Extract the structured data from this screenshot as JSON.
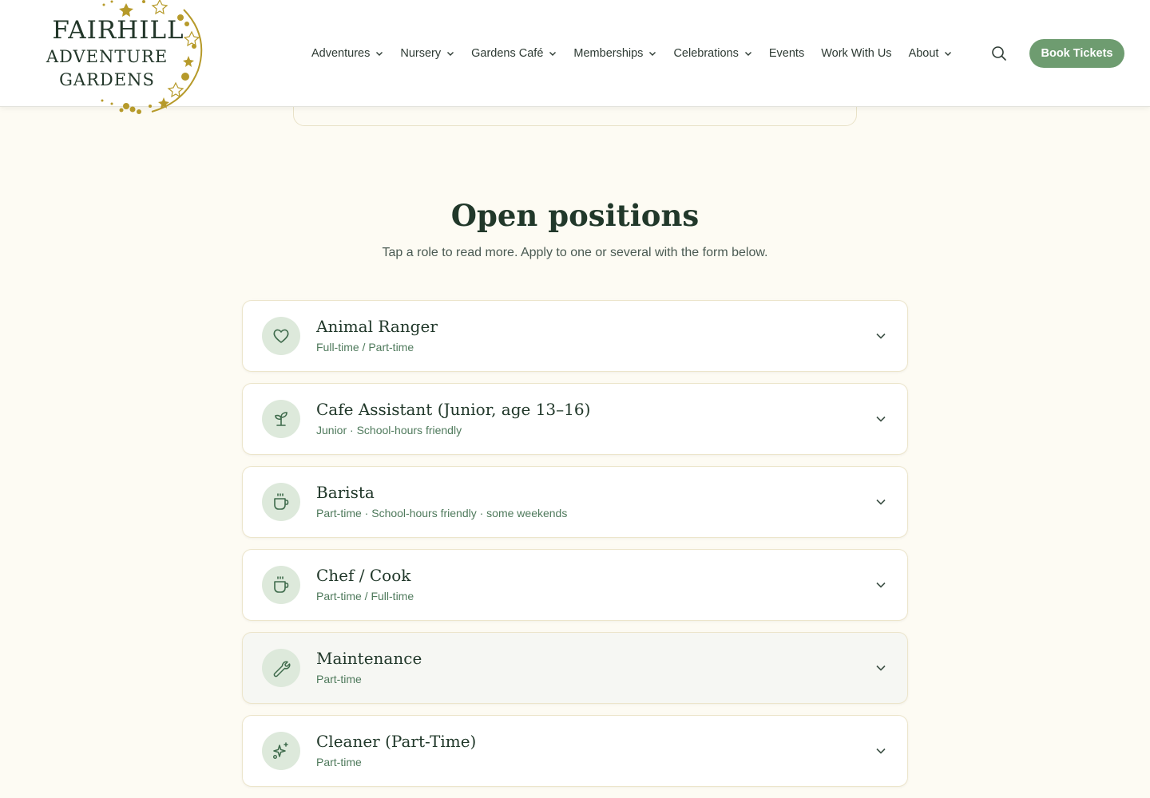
{
  "brand": {
    "line1": "FAIRHILL",
    "line2": "ADVENTURE",
    "line3": "GARDENS",
    "accent": "#b69a2a"
  },
  "nav": {
    "items": [
      {
        "label": "Adventures",
        "has_dropdown": true
      },
      {
        "label": "Nursery",
        "has_dropdown": true
      },
      {
        "label": "Gardens Café",
        "has_dropdown": true
      },
      {
        "label": "Memberships",
        "has_dropdown": true
      },
      {
        "label": "Celebrations",
        "has_dropdown": true
      },
      {
        "label": "Events",
        "has_dropdown": false
      },
      {
        "label": "Work With Us",
        "has_dropdown": false
      },
      {
        "label": "About",
        "has_dropdown": true
      }
    ],
    "search_icon": "search-icon",
    "cta_label": "Book Tickets",
    "cta_color": "#6e9c70"
  },
  "section": {
    "title": "Open positions",
    "subtitle": "Tap a role to read more. Apply to one or several with the form below."
  },
  "positions": [
    {
      "title": "Animal Ranger",
      "meta": "Full-time / Part-time",
      "icon": "heart-icon"
    },
    {
      "title": "Cafe Assistant (Junior, age 13–16)",
      "meta": "Junior · School-hours friendly",
      "icon": "sprout-icon"
    },
    {
      "title": "Barista",
      "meta": "Part-time · School-hours friendly · some weekends",
      "icon": "coffee-cup-icon"
    },
    {
      "title": "Chef / Cook",
      "meta": "Part-time / Full-time",
      "icon": "coffee-cup-icon"
    },
    {
      "title": "Maintenance",
      "meta": "Part-time",
      "icon": "wrench-icon"
    },
    {
      "title": "Cleaner (Part-Time)",
      "meta": "Part-time",
      "icon": "sparkles-icon"
    }
  ]
}
